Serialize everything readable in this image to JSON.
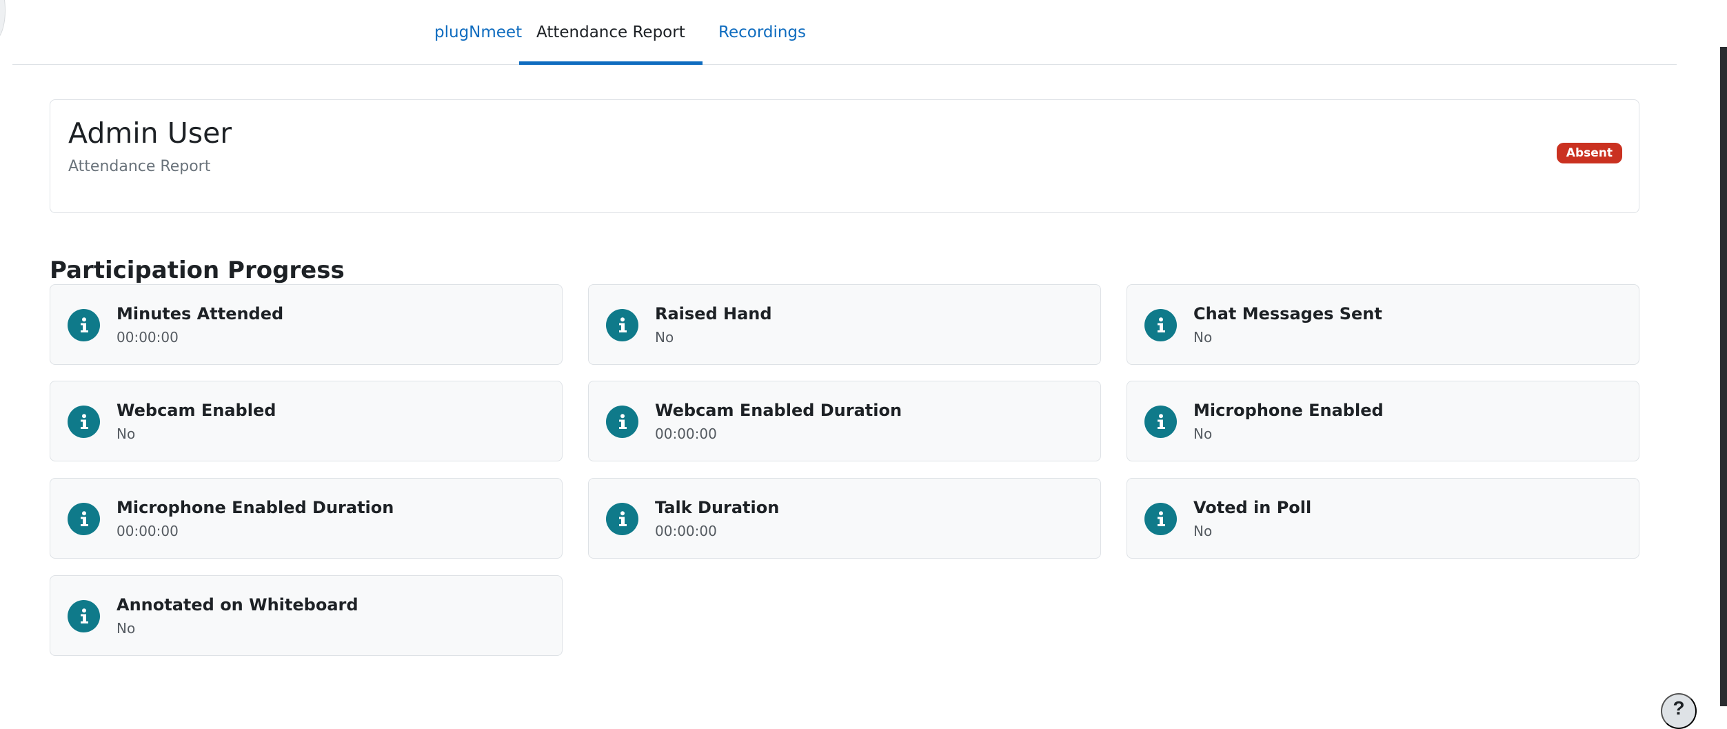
{
  "tabs": [
    {
      "label": "plugNmeet"
    },
    {
      "label": "Attendance Report"
    },
    {
      "label": "Recordings"
    }
  ],
  "user": {
    "name": "Admin User",
    "subtitle": "Attendance Report",
    "status": "Absent"
  },
  "section_title": "Participation Progress",
  "metrics": [
    {
      "label": "Minutes Attended",
      "value": "00:00:00"
    },
    {
      "label": "Raised Hand",
      "value": "No"
    },
    {
      "label": "Chat Messages Sent",
      "value": "No"
    },
    {
      "label": "Webcam Enabled",
      "value": "No"
    },
    {
      "label": "Webcam Enabled Duration",
      "value": "00:00:00"
    },
    {
      "label": "Microphone Enabled",
      "value": "No"
    },
    {
      "label": "Microphone Enabled Duration",
      "value": "00:00:00"
    },
    {
      "label": "Talk Duration",
      "value": "00:00:00"
    },
    {
      "label": "Voted in Poll",
      "value": "No"
    },
    {
      "label": "Annotated on Whiteboard",
      "value": "No"
    }
  ],
  "colors": {
    "accent": "#0f6cbf",
    "info_icon": "#0f7a8a",
    "absent_badge": "#ca3120"
  },
  "icons": {
    "metric": "info-icon",
    "help": "question-icon"
  }
}
